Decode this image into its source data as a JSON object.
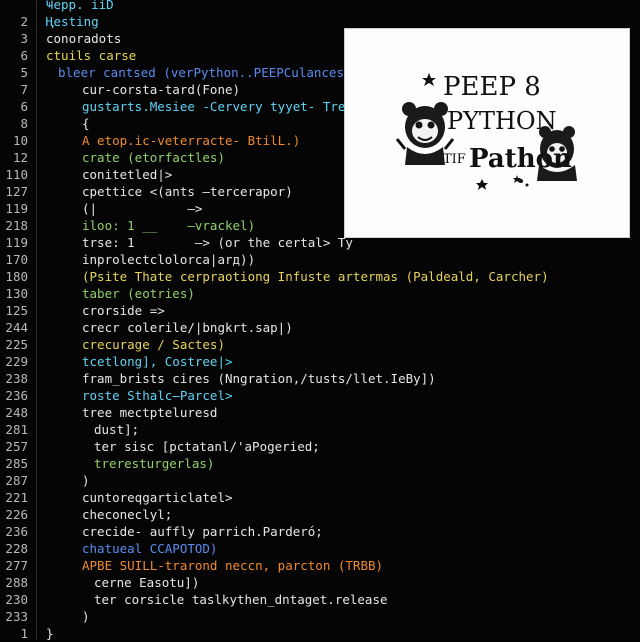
{
  "editor": {
    "lines": [
      {
        "no": "",
        "text": "Ҹepp. ііD",
        "color": "cyan",
        "indent": 0
      },
      {
        "no": "2",
        "text": "Ңesting",
        "color": "cyan",
        "indent": 0
      },
      {
        "no": "3",
        "text": "conoradots",
        "color": "white",
        "indent": 0
      },
      {
        "no": "6",
        "text": "ctuils carse",
        "color": "yellow",
        "indent": 0
      },
      {
        "no": "5",
        "text": "bleer cantsed (verPython..PEEPCulancesty",
        "color": "blue",
        "indent": 1
      },
      {
        "no": "7",
        "text": "cur-corsta-tard(Fone)",
        "color": "white",
        "indent": 3
      },
      {
        "no": "6",
        "text": "gustarts.Mesiee -Cervery tyyet- Tree",
        "color": "cyan",
        "indent": 3
      },
      {
        "no": "8",
        "text": "{",
        "color": "white",
        "indent": 3
      },
      {
        "no": "10",
        "text": "A etop.ic-veterracte- BtilL.)",
        "color": "orange",
        "indent": 3
      },
      {
        "no": "12",
        "text": "crate (etorfactles)",
        "color": "green",
        "indent": 3
      },
      {
        "no": "110",
        "text": "conitetled|>",
        "color": "white",
        "indent": 3
      },
      {
        "no": "127",
        "text": "cpettice <(ants —tercerapor)",
        "color": "white",
        "indent": 3
      },
      {
        "no": "119",
        "text": "(|            —>",
        "color": "white",
        "indent": 3
      },
      {
        "no": "218",
        "text": "iloo: 1 __    —vrackel)",
        "color": "green",
        "indent": 3
      },
      {
        "no": "119",
        "text": "trse: 1        —> (or the certal> Ty",
        "color": "white",
        "indent": 3
      },
      {
        "no": "170",
        "text": "inprolectclolorcа|arд))",
        "color": "white",
        "indent": 3
      },
      {
        "no": "180",
        "text": "(Psite Thate cerpraotiong Infuste artermas (Paldeald, Carcher)",
        "color": "yellow",
        "indent": 3
      },
      {
        "no": "130",
        "text": "taber (eotries)",
        "color": "green",
        "indent": 3
      },
      {
        "no": "125",
        "text": "crorside =>",
        "color": "white",
        "indent": 3
      },
      {
        "no": "244",
        "text": "crecr colerile/|bngkrt.sap|)",
        "color": "white",
        "indent": 3
      },
      {
        "no": "225",
        "text": "crecurage / Sactes)",
        "color": "yellow",
        "indent": 3
      },
      {
        "no": "229",
        "text": "tcetlong], Costree|>",
        "color": "cyan",
        "indent": 3
      },
      {
        "no": "238",
        "text": "fram_brists cires (Nngration,/tusts/llet.IeBy])",
        "color": "white",
        "indent": 3
      },
      {
        "no": "236",
        "text": "roste Sthalc—Parcel>",
        "color": "cyan",
        "indent": 3
      },
      {
        "no": "248",
        "text": "tree mectpteluresd",
        "color": "white",
        "indent": 3
      },
      {
        "no": "281",
        "text": "dust];",
        "color": "white",
        "indent": 4
      },
      {
        "no": "257",
        "text": "ter sisc [pctatanl/'aPogeried;",
        "color": "white",
        "indent": 4
      },
      {
        "no": "285",
        "text": "treresturgerlas)",
        "color": "green",
        "indent": 4
      },
      {
        "no": "287",
        "text": ")",
        "color": "white",
        "indent": 3
      },
      {
        "no": "221",
        "text": "cuntoreqgarticlatel>",
        "color": "white",
        "indent": 3
      },
      {
        "no": "226",
        "text": "checoneclyl;",
        "color": "white",
        "indent": 3
      },
      {
        "no": "236",
        "text": "crecide- auffly parrich.Parderó;",
        "color": "white",
        "indent": 3
      },
      {
        "no": "228",
        "text": "chatueal CCAPOTOD)",
        "color": "blue",
        "indent": 3
      },
      {
        "no": "277",
        "text": "APBE SUILL-trarond neccn, parcton (TRBB)",
        "color": "orange",
        "indent": 3
      },
      {
        "no": "288",
        "text": "cerne Easotu])",
        "color": "white",
        "indent": 4
      },
      {
        "no": "230",
        "text": "ter corsicle taslkythen_dntaget.release",
        "color": "white",
        "indent": 4
      },
      {
        "no": "233",
        "text": ")",
        "color": "white",
        "indent": 3
      },
      {
        "no": "1",
        "text": "}",
        "color": "white",
        "indent": 0
      }
    ]
  },
  "preview": {
    "line1": "PEEP 8",
    "line2": "PYTHON",
    "line3_prefix": "TIF",
    "line3_word": "Pathon"
  },
  "colors": {
    "background": "#050505",
    "line_number": "#b8b8b8",
    "cyan": "#5fd3f3",
    "yellow": "#e7d35a",
    "orange": "#f08a2a",
    "green": "#8fd16a",
    "blue": "#5a8cf0",
    "white": "#e6e6e6"
  }
}
